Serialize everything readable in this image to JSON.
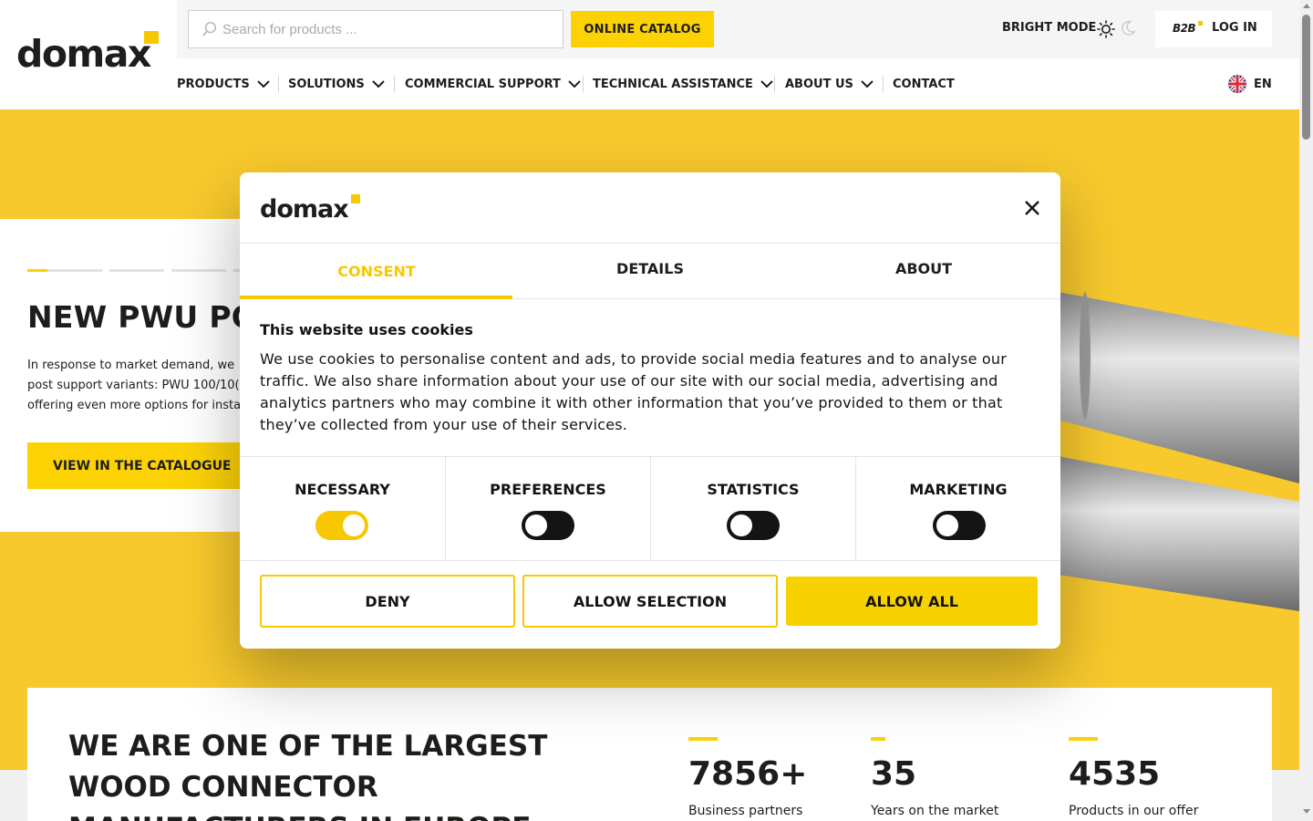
{
  "header": {
    "logo_text": "domax",
    "search": {
      "placeholder": "Search for products ..."
    },
    "catalog_button": "ONLINE CATALOG",
    "mode_label": "BRIGHT MODE",
    "b2b_label": "B2B",
    "login_label": "LOG IN",
    "nav": [
      {
        "label": "PRODUCTS",
        "has_dropdown": true
      },
      {
        "label": "SOLUTIONS",
        "has_dropdown": true
      },
      {
        "label": "COMMERCIAL SUPPORT",
        "has_dropdown": true
      },
      {
        "label": "TECHNICAL ASSISTANCE",
        "has_dropdown": true
      },
      {
        "label": "ABOUT US",
        "has_dropdown": true
      },
      {
        "label": "CONTACT",
        "has_dropdown": false
      }
    ],
    "language": "EN"
  },
  "hero": {
    "title": "NEW PWU POS",
    "description": "In response to market demand, we\npost support variants: PWU 100/10(\noffering even more options for insta",
    "button": "VIEW IN THE CATALOGUE",
    "slides": 5,
    "active_slide": 1
  },
  "stats": {
    "title": "WE ARE ONE OF THE LARGEST WOOD CONNECTOR MANUFACTURERS IN EUROPE",
    "items": [
      {
        "value": "7856+",
        "label": "Business partners"
      },
      {
        "value": "35",
        "label": "Years on the market"
      },
      {
        "value": "4535",
        "label": "Products in our offer"
      }
    ]
  },
  "cookie_modal": {
    "logo_text": "domax",
    "tabs": [
      "CONSENT",
      "DETAILS",
      "ABOUT"
    ],
    "active_tab": "CONSENT",
    "heading": "This website uses cookies",
    "text": "We use cookies to personalise content and ads, to provide social media features and to analyse our traffic. We also share information about your use of our site with our social media, advertising and analytics partners who may combine it with other information that you’ve provided to them or that they’ve collected from your use of their services.",
    "toggles": [
      {
        "label": "NECESSARY",
        "on": true
      },
      {
        "label": "PREFERENCES",
        "on": false
      },
      {
        "label": "STATISTICS",
        "on": false
      },
      {
        "label": "MARKETING",
        "on": false
      }
    ],
    "buttons": {
      "deny": "DENY",
      "allow_selection": "ALLOW SELECTION",
      "allow_all": "ALLOW ALL"
    }
  },
  "colors": {
    "accent": "#fcd205",
    "hero_bg": "#f7c92c",
    "text": "#1d1d1b"
  }
}
